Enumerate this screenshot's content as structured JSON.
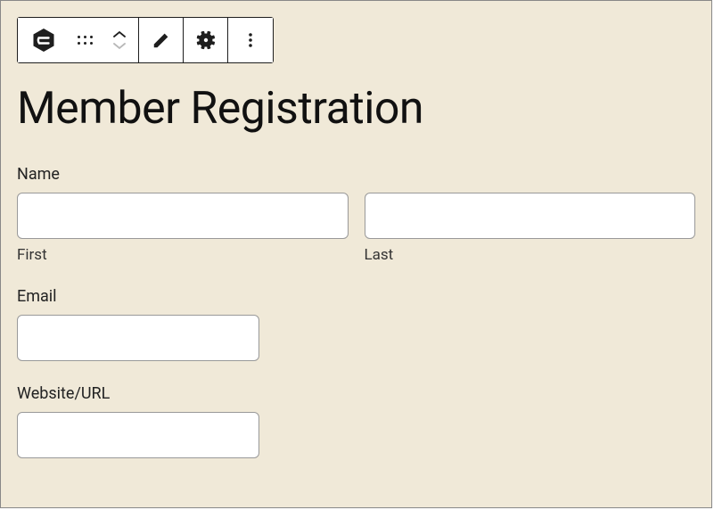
{
  "heading": "Member Registration",
  "toolbar": {
    "block_icon_name": "gravity-forms-block",
    "tools": {
      "drag": "drag-handle",
      "move_up": "move-up",
      "move_down": "move-down",
      "edit": "edit",
      "settings": "settings",
      "more": "more-options"
    }
  },
  "form": {
    "name": {
      "label": "Name",
      "first_sublabel": "First",
      "last_sublabel": "Last",
      "first_value": "",
      "last_value": ""
    },
    "email": {
      "label": "Email",
      "value": ""
    },
    "website": {
      "label": "Website/URL",
      "value": ""
    }
  }
}
